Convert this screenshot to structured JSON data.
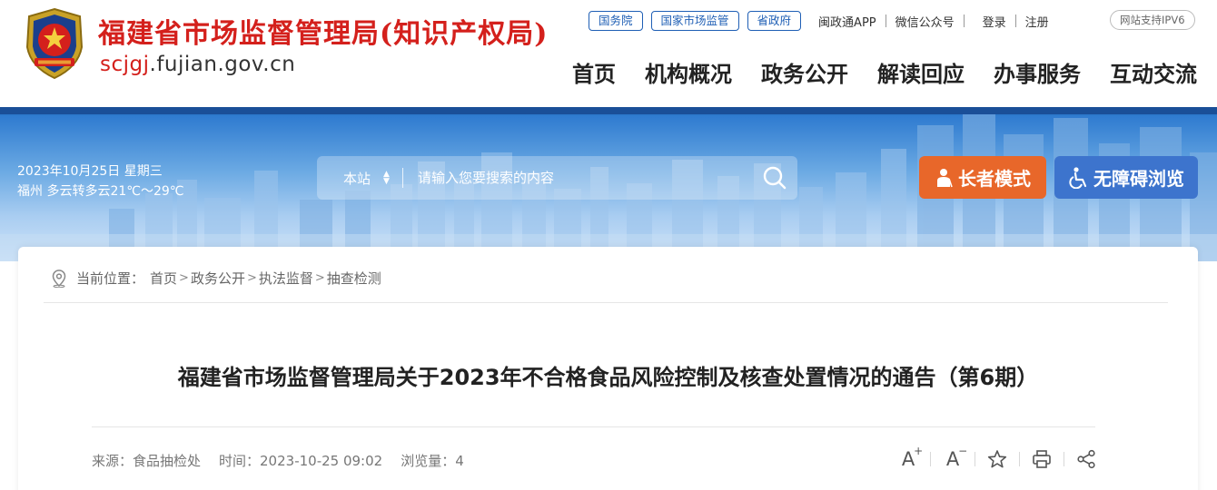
{
  "header": {
    "site_title": "福建省市场监督管理局(知识产权局)",
    "domain_prefix": "scjgj",
    "domain_rest": ".fujian.gov.cn",
    "emblem_icon": "police-emblem-icon",
    "top_pills": [
      "国务院",
      "国家市场监管",
      "省政府"
    ],
    "top_links": [
      "闽政通APP",
      "微信公众号",
      "登录",
      "注册"
    ],
    "ipv6_label": "网站支持IPV6",
    "nav": [
      "首页",
      "机构概况",
      "政务公开",
      "解读回应",
      "办事服务",
      "互动交流"
    ]
  },
  "banner": {
    "date_line": "2023年10月25日 星期三",
    "weather_line": "福州 多云转多云21℃～29℃",
    "search_scope": "本站",
    "search_placeholder": "请输入您要搜索的内容",
    "elder_mode_label": "长者模式",
    "accessible_label": "无障碍浏览"
  },
  "breadcrumb": {
    "prefix": "当前位置：",
    "items": [
      "首页",
      "政务公开",
      "执法监督",
      "抽查检测"
    ],
    "separator": ">"
  },
  "article": {
    "title": "福建省市场监督管理局关于2023年不合格食品风险控制及核查处置情况的通告（第6期）",
    "source": "来源：食品抽检处",
    "time": "时间：2023-10-25 09:02",
    "views": "浏览量：4",
    "tools": {
      "font_plus": "A",
      "font_plus_sup": "+",
      "font_minus": "A",
      "font_minus_sup": "−"
    }
  },
  "colors": {
    "brand_red": "#d4201c",
    "brand_blue": "#1f5fb5",
    "elder_orange": "#e8672a",
    "access_blue": "#3d74cd"
  }
}
